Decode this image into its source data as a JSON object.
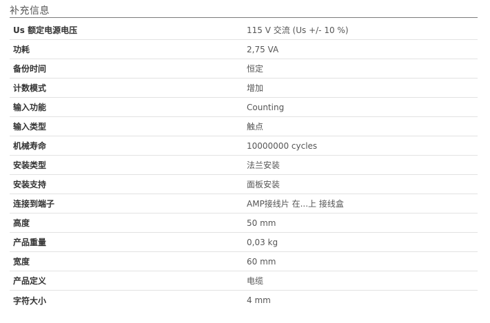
{
  "section": {
    "title": "补充信息"
  },
  "rows": [
    {
      "label": "Us 额定电源电压",
      "value": "115 V 交流 (Us +/- 10 %)"
    },
    {
      "label": "功耗",
      "value": "2,75 VA"
    },
    {
      "label": "备份时间",
      "value": "恒定"
    },
    {
      "label": "计数模式",
      "value": "增加"
    },
    {
      "label": "输入功能",
      "value": "Counting"
    },
    {
      "label": "输入类型",
      "value": "触点"
    },
    {
      "label": "机械寿命",
      "value": "10000000 cycles"
    },
    {
      "label": "安装类型",
      "value": "法兰安装"
    },
    {
      "label": "安装支持",
      "value": "面板安装"
    },
    {
      "label": "连接到端子",
      "value": "AMP接线片 在...上 接线盒"
    },
    {
      "label": "高度",
      "value": "50 mm"
    },
    {
      "label": "产品重量",
      "value": "0,03 kg"
    },
    {
      "label": "宽度",
      "value": "60 mm"
    },
    {
      "label": "产品定义",
      "value": "电缆"
    },
    {
      "label": "字符大小",
      "value": "4 mm"
    }
  ]
}
